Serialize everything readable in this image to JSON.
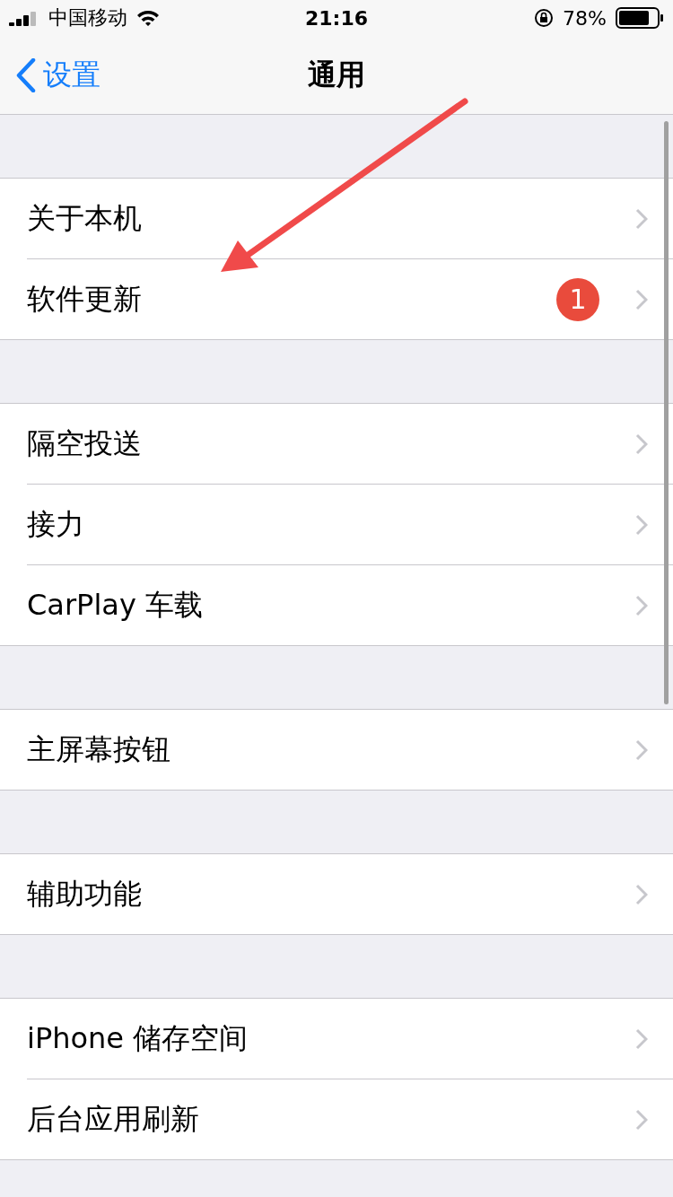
{
  "status_bar": {
    "carrier": "中国移动",
    "time": "21:16",
    "battery": "78%"
  },
  "nav": {
    "back": "设置",
    "title": "通用"
  },
  "sections": [
    {
      "rows": [
        {
          "label": "关于本机"
        },
        {
          "label": "软件更新",
          "badge": "1"
        }
      ]
    },
    {
      "rows": [
        {
          "label": "隔空投送"
        },
        {
          "label": "接力"
        },
        {
          "label": "CarPlay 车载"
        }
      ]
    },
    {
      "rows": [
        {
          "label": "主屏幕按钮"
        }
      ]
    },
    {
      "rows": [
        {
          "label": "辅助功能"
        }
      ]
    },
    {
      "rows": [
        {
          "label": "iPhone 储存空间"
        },
        {
          "label": "后台应用刷新"
        }
      ]
    }
  ]
}
